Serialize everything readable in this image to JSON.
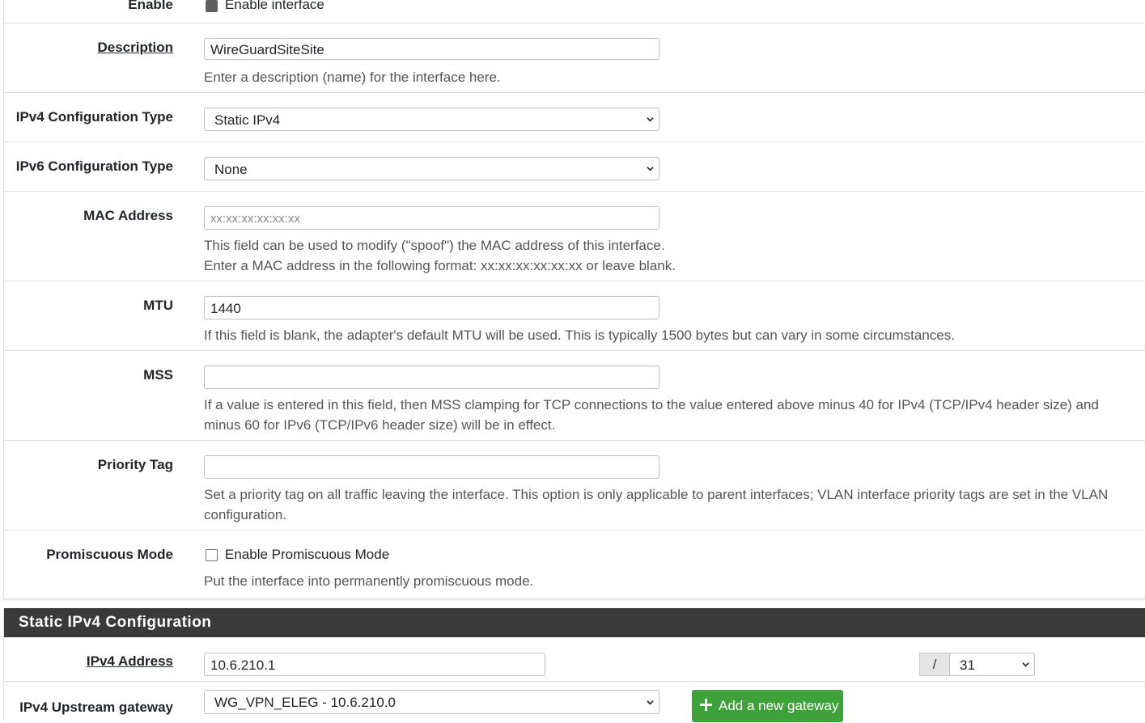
{
  "interface_form": {
    "enable": {
      "label": "Enable",
      "checkbox_label": "Enable interface"
    },
    "description": {
      "label": "Description",
      "value": "WireGuardSiteSite",
      "help": "Enter a description (name) for the interface here."
    },
    "ipv4_type": {
      "label": "IPv4 Configuration Type",
      "value": "Static IPv4"
    },
    "ipv6_type": {
      "label": "IPv6 Configuration Type",
      "value": "None"
    },
    "mac": {
      "label": "MAC Address",
      "placeholder": "xx:xx:xx:xx:xx:xx",
      "help1": "This field can be used to modify (\"spoof\") the MAC address of this interface.",
      "help2": "Enter a MAC address in the following format: xx:xx:xx:xx:xx:xx or leave blank."
    },
    "mtu": {
      "label": "MTU",
      "value": "1440",
      "help": "If this field is blank, the adapter's default MTU will be used. This is typically 1500 bytes but can vary in some circumstances."
    },
    "mss": {
      "label": "MSS",
      "value": "",
      "help1": "If a value is entered in this field, then MSS clamping for TCP connections to the value entered above minus 40 for IPv4 (TCP/IPv4 header size) and",
      "help2": "minus 60 for IPv6 (TCP/IPv6 header size) will be in effect."
    },
    "priority": {
      "label": "Priority Tag",
      "value": "",
      "help1": "Set a priority tag on all traffic leaving the interface. This option is only applicable to parent interfaces; VLAN interface priority tags are set in the VLAN",
      "help2": "configuration."
    },
    "promisc": {
      "label": "Promiscuous Mode",
      "checkbox_label": "Enable Promiscuous Mode",
      "help": "Put the interface into permanently promiscuous mode."
    }
  },
  "static_ipv4": {
    "title": "Static IPv4 Configuration",
    "address": {
      "label": "IPv4 Address",
      "value": "10.6.210.1",
      "slash": "/",
      "cidr": "31"
    },
    "gateway": {
      "label": "IPv4 Upstream gateway",
      "value": "WG_VPN_ELEG - 10.6.210.0",
      "add_button": "Add a new gateway"
    }
  }
}
